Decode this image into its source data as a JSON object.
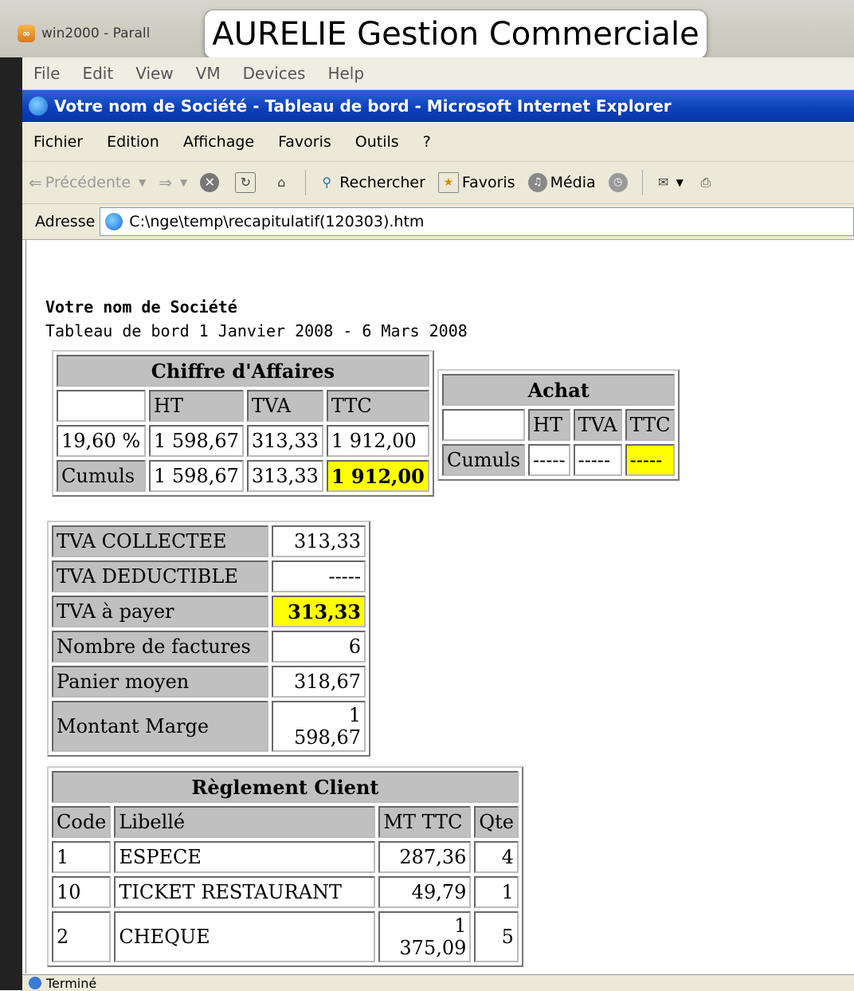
{
  "parallels": {
    "window_title": "win2000 - Parall",
    "banner": "AURELIE Gestion Commerciale",
    "menu": [
      "File",
      "Edit",
      "View",
      "VM",
      "Devices",
      "Help"
    ]
  },
  "ie": {
    "title": "Votre nom de Société - Tableau de bord - Microsoft Internet Explorer",
    "menu": [
      "Fichier",
      "Edition",
      "Affichage",
      "Favoris",
      "Outils",
      "?"
    ],
    "toolbar": {
      "back": "Précédente",
      "search": "Rechercher",
      "favorites": "Favoris",
      "media": "Média"
    },
    "address_label": "Adresse",
    "address_value": "C:\\nge\\temp\\recapitulatif(120303).htm",
    "status": "Terminé"
  },
  "report": {
    "company": "Votre nom de Société",
    "subtitle": "Tableau de bord 1 Janvier 2008 - 6 Mars 2008",
    "ca": {
      "title": "Chiffre d'Affaires",
      "headers": [
        "",
        "HT",
        "TVA",
        "TTC"
      ],
      "rows": [
        [
          "19,60 %",
          "1 598,67",
          "313,33",
          "1 912,00"
        ],
        [
          "Cumuls",
          "1 598,67",
          "313,33",
          "1 912,00"
        ]
      ]
    },
    "achat": {
      "title": "Achat",
      "headers": [
        "",
        "HT",
        "TVA",
        "TTC"
      ],
      "rows": [
        [
          "Cumuls",
          "-----",
          "-----",
          "-----"
        ]
      ]
    },
    "summary": [
      {
        "label": "TVA COLLECTEE",
        "value": "313,33"
      },
      {
        "label": "TVA DEDUCTIBLE",
        "value": "-----"
      },
      {
        "label": "TVA à payer",
        "value": "313,33"
      },
      {
        "label": "Nombre de factures",
        "value": "6"
      },
      {
        "label": "Panier moyen",
        "value": "318,67"
      },
      {
        "label": "Montant Marge",
        "value": "1 598,67"
      }
    ],
    "reglement": {
      "title": "Règlement Client",
      "headers": [
        "Code",
        "Libellé",
        "MT TTC",
        "Qte"
      ],
      "rows": [
        [
          "1",
          "ESPECE",
          "287,36",
          "4"
        ],
        [
          "10",
          "TICKET RESTAURANT",
          "49,79",
          "1"
        ],
        [
          "2",
          "CHEQUE",
          "1 375,09",
          "5"
        ]
      ]
    }
  }
}
